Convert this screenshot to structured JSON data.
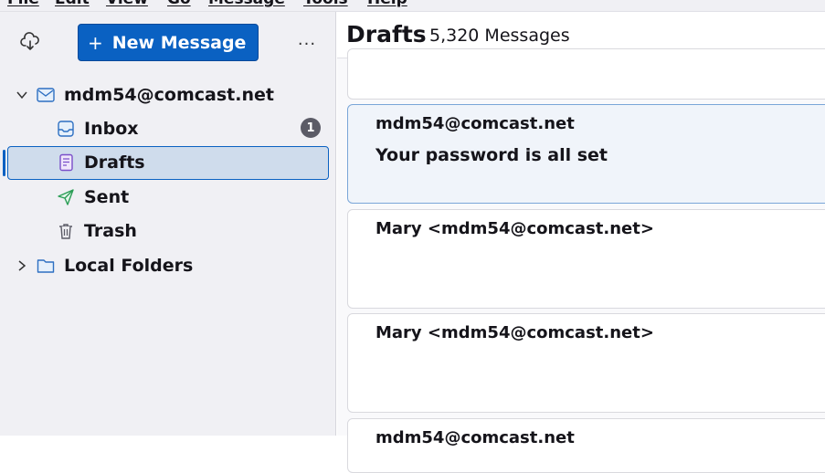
{
  "menu": {
    "items": [
      "File",
      "Edit",
      "View",
      "Go",
      "Message",
      "Tools",
      "Help"
    ]
  },
  "sidebar": {
    "new_message_label": "New Message",
    "more_label": "...",
    "account": "mdm54@comcast.net",
    "folders": [
      {
        "label": "Inbox",
        "icon": "inbox-icon",
        "badge": "1"
      },
      {
        "label": "Drafts",
        "icon": "drafts-icon"
      },
      {
        "label": "Sent",
        "icon": "sent-icon"
      },
      {
        "label": "Trash",
        "icon": "trash-icon"
      }
    ],
    "local_folders": "Local Folders"
  },
  "main": {
    "title": "Drafts",
    "count": "5,320 Messages",
    "cards": [
      {
        "from": "",
        "subject": ""
      },
      {
        "from": "mdm54@comcast.net",
        "subject": "Your password is all set"
      },
      {
        "from": "Mary <mdm54@comcast.net>",
        "subject": ""
      },
      {
        "from": "Mary <mdm54@comcast.net>",
        "subject": ""
      },
      {
        "from": "mdm54@comcast.net",
        "subject": ""
      }
    ]
  },
  "colors": {
    "accent": "#0a61c2",
    "selected_bg": "#cfdcec",
    "sidebar_bg": "#f0f0f4"
  }
}
